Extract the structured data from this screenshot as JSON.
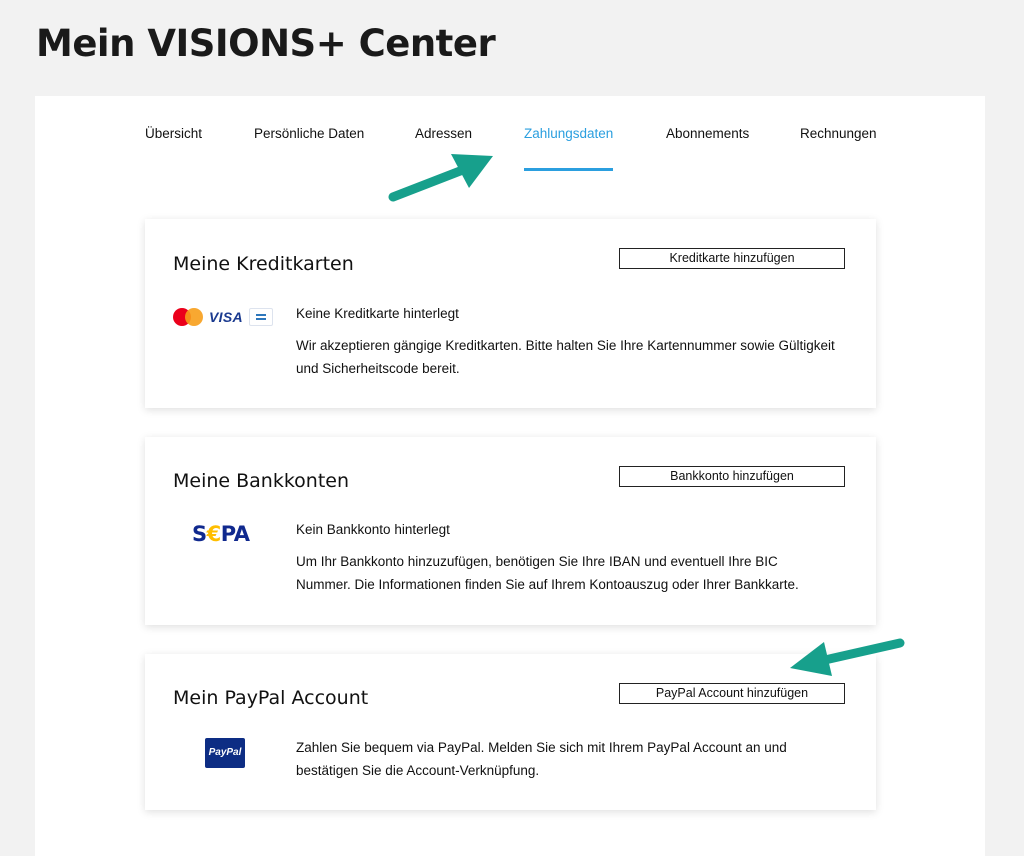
{
  "page": {
    "title": "Mein VISIONS+ Center"
  },
  "tabs": [
    {
      "label": "Übersicht",
      "active": false
    },
    {
      "label": "Persönliche Daten",
      "active": false
    },
    {
      "label": "Adressen",
      "active": false
    },
    {
      "label": "Zahlungsdaten",
      "active": true
    },
    {
      "label": "Abonnements",
      "active": false
    },
    {
      "label": "Rechnungen",
      "active": false
    }
  ],
  "colors": {
    "accent": "#2b9fdf",
    "annotation_arrow": "#17a08c"
  },
  "cards": {
    "credit": {
      "title": "Meine Kreditkarten",
      "button": "Kreditkarte hinzufügen",
      "status": "Keine Kreditkarte hinterlegt",
      "description": "Wir akzeptieren gängige Kreditkarten. Bitte halten Sie Ihre Kartennummer sowie Gültigkeit und Sicherheitscode bereit.",
      "icons": {
        "mastercard": "mastercard-icon",
        "visa": {
          "name": "visa-icon",
          "text": "VISA"
        },
        "amex": "amex-icon"
      }
    },
    "bank": {
      "title": "Meine Bankkonten",
      "button": "Bankkonto hinzufügen",
      "status": "Kein Bankkonto hinterlegt",
      "description": "Um Ihr Bankkonto hinzuzufügen, benötigen Sie Ihre IBAN und eventuell Ihre BIC Nummer. Die Informationen finden Sie auf Ihrem Kontoauszug oder Ihrer Bankkarte.",
      "icon": {
        "name": "sepa-logo-icon",
        "text_before": "S",
        "text_euro": "€",
        "text_after": "PA"
      }
    },
    "paypal": {
      "title": "Mein PayPal Account",
      "button": "PayPal Account hinzufügen",
      "description": "Zahlen Sie bequem via PayPal. Melden Sie sich mit Ihrem PayPal Account an und bestätigen Sie die Account-Verknüpfung.",
      "icon": {
        "name": "paypal-logo-icon",
        "text": "PayPal"
      }
    }
  }
}
